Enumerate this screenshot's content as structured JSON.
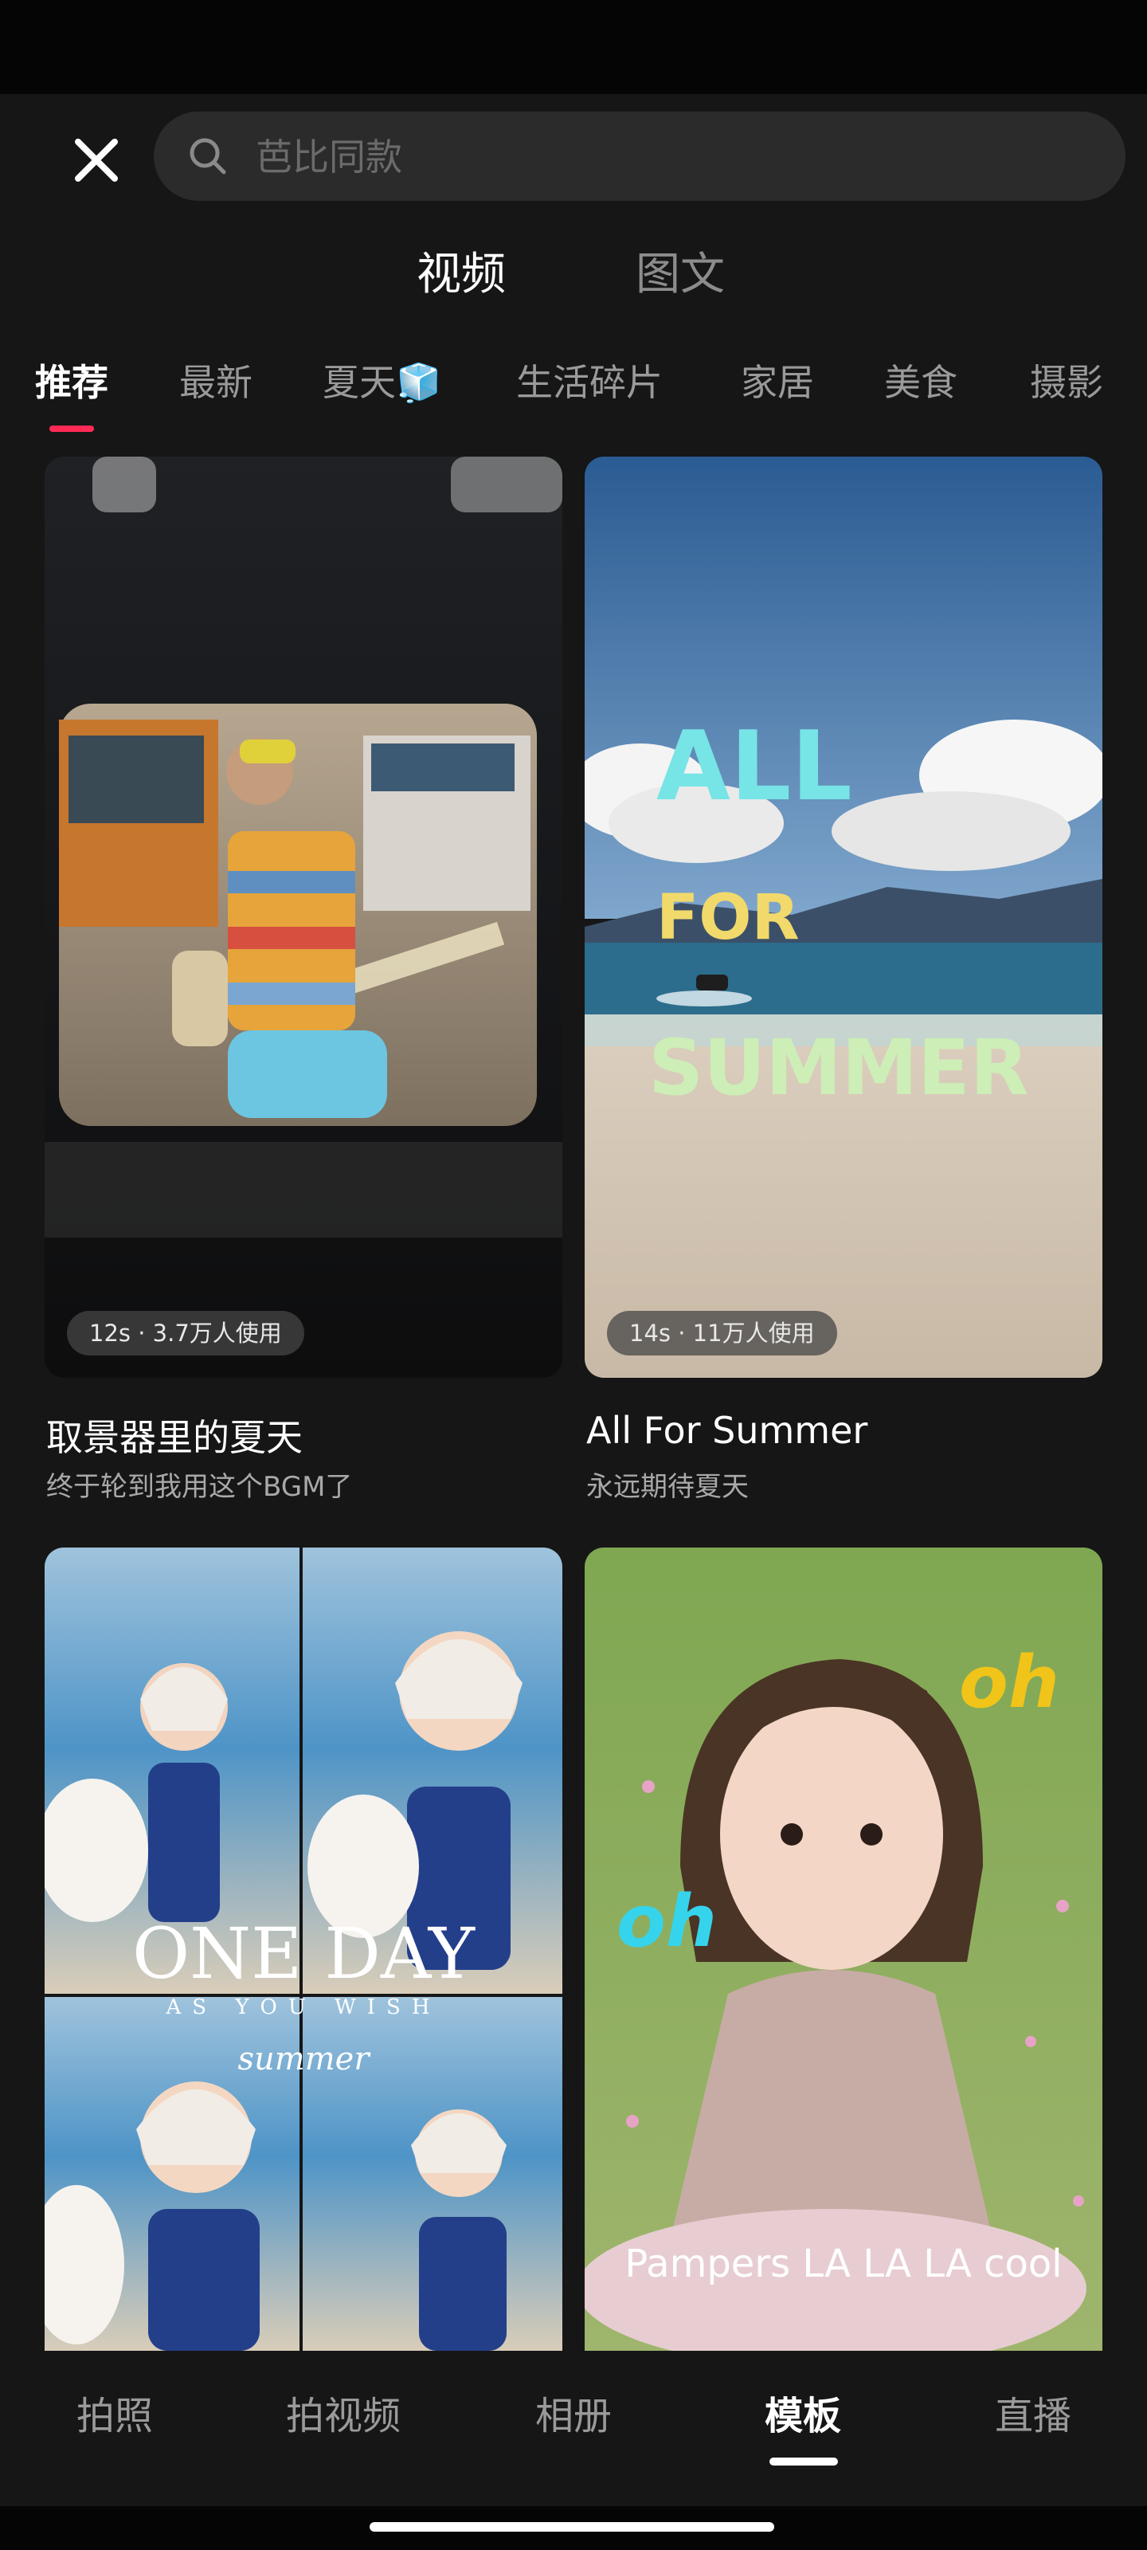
{
  "search": {
    "placeholder": "芭比同款"
  },
  "type_tabs": [
    {
      "label": "视频",
      "active": true
    },
    {
      "label": "图文",
      "active": false
    }
  ],
  "categories": [
    {
      "label": "推荐",
      "active": true
    },
    {
      "label": "最新"
    },
    {
      "label": "夏天🧊"
    },
    {
      "label": "生活碎片"
    },
    {
      "label": "家居"
    },
    {
      "label": "美食"
    },
    {
      "label": "摄影"
    }
  ],
  "templates": [
    {
      "badge": "12s · 3.7万人使用",
      "title": "取景器里的夏天",
      "subtitle": "终于轮到我用这个BGM了"
    },
    {
      "badge": "14s · 11万人使用",
      "title": "All For Summer",
      "subtitle": "永远期待夏天",
      "overlay": [
        "ALL",
        "FOR",
        "SUMMER"
      ]
    },
    {
      "overlay": [
        "ONE DAY",
        "AS YOU WISH",
        "summer"
      ]
    },
    {
      "overlay": [
        "oh",
        "oh",
        "Pampers LA LA LA cool"
      ]
    }
  ],
  "bottom_nav": [
    {
      "label": "拍照"
    },
    {
      "label": "拍视频"
    },
    {
      "label": "相册"
    },
    {
      "label": "模板",
      "active": true
    },
    {
      "label": "直播"
    }
  ],
  "colors": {
    "accent": "#ff2b55",
    "background": "#161616",
    "search_bg": "#2b2b2b"
  },
  "icons": {
    "close": "close-icon",
    "search": "search-icon"
  }
}
